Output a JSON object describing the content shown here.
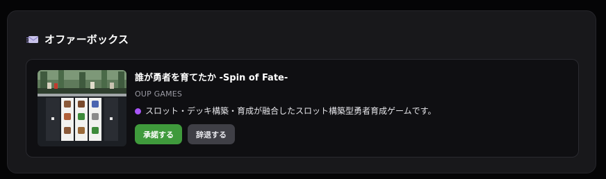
{
  "panel": {
    "title": "オファーボックス",
    "icon": "envelope-icon"
  },
  "offer": {
    "game_title": "誰が勇者を育てたか -Spin of Fate-",
    "publisher": "OUP GAMES",
    "description": "スロット・デッキ構築・育成が融合したスロット構築型勇者育成ゲームです。",
    "status_dot_color": "#a855f7",
    "accept_label": "承諾する",
    "decline_label": "辞退する",
    "accept_color": "#3f9a3c",
    "decline_color": "#3f3f46"
  }
}
